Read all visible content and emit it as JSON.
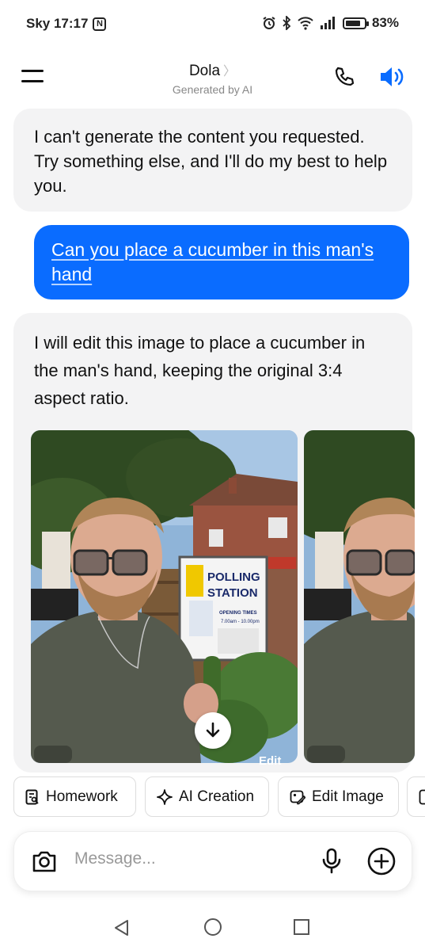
{
  "status_bar": {
    "carrier_time": "Sky 17:17",
    "nfc_label": "N",
    "battery_percent": "83%",
    "battery_level": 0.83
  },
  "header": {
    "title": "Dola",
    "title_chevron": "〉",
    "subtitle": "Generated by AI"
  },
  "messages": [
    {
      "role": "ai",
      "text": "I can't generate the content you requested. Try something else, and I'll do my best to help you."
    },
    {
      "role": "user",
      "text": "Can you place a cucumber in this man's hand"
    },
    {
      "role": "ai",
      "text": "I will edit this image to place a cucumber in the man's hand, keeping the original 3:4 aspect ratio."
    }
  ],
  "image_card": {
    "sign_line1": "POLLING",
    "sign_line2": "STATION",
    "sign_small": "OPENING TIMES",
    "sign_hours": "7.00am - 10.00pm",
    "edit_label": "Edit"
  },
  "chips": [
    {
      "label": "Homework",
      "icon": "homework-icon"
    },
    {
      "label": "AI Creation",
      "icon": "sparkle-icon"
    },
    {
      "label": "Edit Image",
      "icon": "edit-image-icon"
    }
  ],
  "input": {
    "placeholder": "Message..."
  },
  "colors": {
    "accent": "#0a6cff",
    "ai_bubble": "#f3f3f4"
  }
}
